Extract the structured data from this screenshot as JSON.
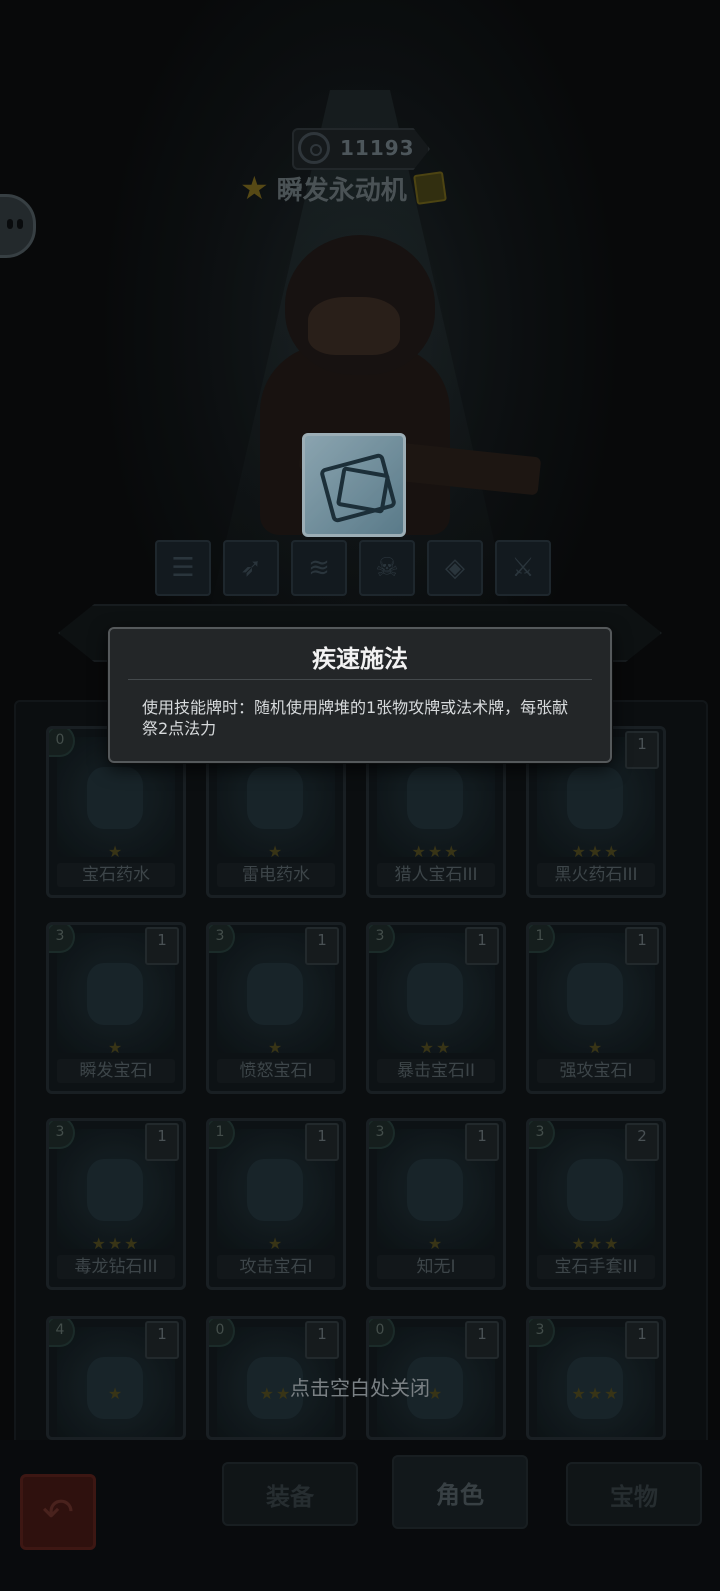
{
  "hero": {
    "power": "11193",
    "name": "瞬发永动机"
  },
  "tooltip": {
    "title": "疾速施法",
    "description": "使用技能牌时：随机使用牌堆的1张物攻牌或法术牌，每张献祭2点法力"
  },
  "cards": [
    {
      "cost": "0",
      "level": "",
      "name": "宝石药水",
      "stars": "★"
    },
    {
      "cost": "",
      "level": "",
      "name": "雷电药水",
      "stars": "★"
    },
    {
      "cost": "",
      "level": "",
      "name": "猎人宝石III",
      "stars": "★★★"
    },
    {
      "cost": "",
      "level": "1",
      "name": "黑火药石III",
      "stars": "★★★"
    },
    {
      "cost": "3",
      "level": "1",
      "name": "瞬发宝石I",
      "stars": "★"
    },
    {
      "cost": "3",
      "level": "1",
      "name": "愤怒宝石I",
      "stars": "★"
    },
    {
      "cost": "3",
      "level": "1",
      "name": "暴击宝石II",
      "stars": "★★"
    },
    {
      "cost": "1",
      "level": "1",
      "name": "强攻宝石I",
      "stars": "★"
    },
    {
      "cost": "3",
      "level": "1",
      "name": "毒龙钻石III",
      "stars": "★★★"
    },
    {
      "cost": "1",
      "level": "1",
      "name": "攻击宝石I",
      "stars": "★"
    },
    {
      "cost": "3",
      "level": "1",
      "name": "知无I",
      "stars": "★"
    },
    {
      "cost": "3",
      "level": "2",
      "name": "宝石手套III",
      "stars": "★★★"
    },
    {
      "cost": "4",
      "level": "1",
      "name": "",
      "stars": "★"
    },
    {
      "cost": "0",
      "level": "1",
      "name": "",
      "stars": "★★"
    },
    {
      "cost": "0",
      "level": "1",
      "name": "",
      "stars": "★"
    },
    {
      "cost": "3",
      "level": "1",
      "name": "",
      "stars": "★★★"
    }
  ],
  "close_hint": "点击空白处关闭",
  "tabs": [
    {
      "label": "装备",
      "active": false
    },
    {
      "label": "角色",
      "active": true
    },
    {
      "label": "宝物",
      "active": false
    }
  ],
  "colors": {
    "tooltip_bg": "#232628",
    "tooltip_border": "#55595b",
    "star": "#e0b400",
    "back_button": "#a02a20"
  }
}
